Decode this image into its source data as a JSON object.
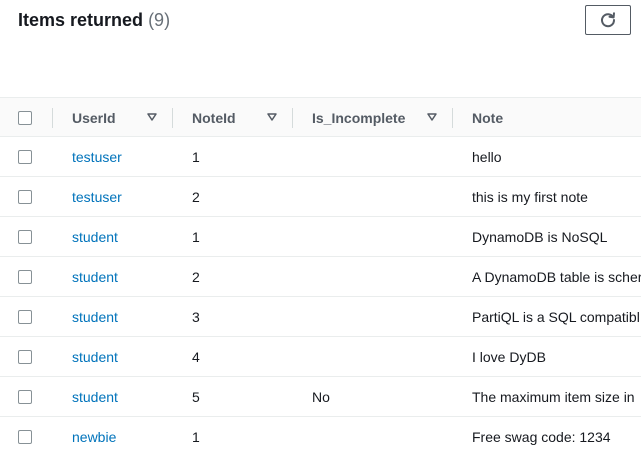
{
  "header": {
    "title": "Items returned",
    "count": "(9)",
    "refresh_icon": "refresh-icon"
  },
  "table": {
    "columns": [
      "UserId",
      "NoteId",
      "Is_Incomplete",
      "Note"
    ],
    "sort_icon": "triangle-down-icon",
    "rows": [
      {
        "user": "testuser",
        "note_id": "1",
        "incomplete": "",
        "note": "hello"
      },
      {
        "user": "testuser",
        "note_id": "2",
        "incomplete": "",
        "note": "this is my first note"
      },
      {
        "user": "student",
        "note_id": "1",
        "incomplete": "",
        "note": "DynamoDB is NoSQL"
      },
      {
        "user": "student",
        "note_id": "2",
        "incomplete": "",
        "note": "A DynamoDB table is scher"
      },
      {
        "user": "student",
        "note_id": "3",
        "incomplete": "",
        "note": "PartiQL is a SQL compatibl"
      },
      {
        "user": "student",
        "note_id": "4",
        "incomplete": "",
        "note": "I love DyDB"
      },
      {
        "user": "student",
        "note_id": "5",
        "incomplete": "No",
        "note": "The maximum item size in"
      },
      {
        "user": "newbie",
        "note_id": "1",
        "incomplete": "",
        "note": "Free swag code: 1234"
      }
    ]
  },
  "colors": {
    "link": "#0073bb",
    "header_bg": "#fafafa",
    "border": "#eaeded"
  }
}
